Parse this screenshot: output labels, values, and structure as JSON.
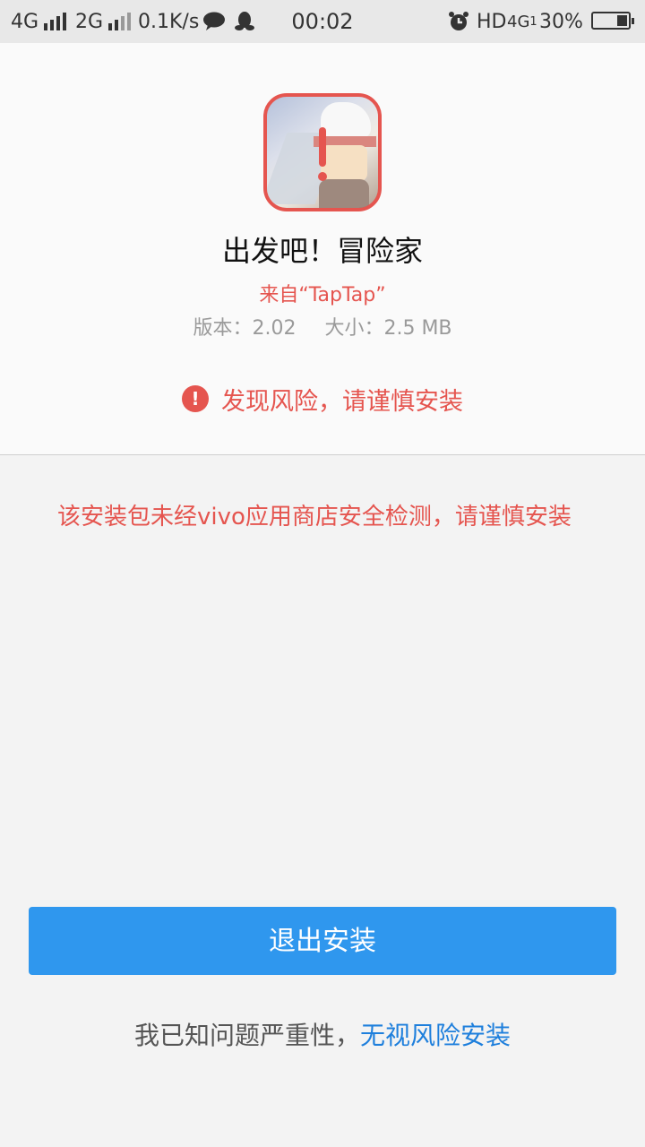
{
  "status_bar": {
    "sim1": "4G",
    "sim2": "2G",
    "speed": "0.1K/s",
    "time": "00:02",
    "hd": "HD",
    "net": "4G",
    "net_sub": "1",
    "battery_text": "30%",
    "battery_level": 0.3,
    "icons": [
      "signal-bars-icon",
      "message-bubble-icon",
      "qq-penguin-icon",
      "alarm-clock-icon",
      "battery-icon"
    ]
  },
  "app": {
    "name": "出发吧！冒险家",
    "source": "来自“TapTap”",
    "version": "版本：2.02",
    "size": "大小：2.5 MB",
    "icon": "app-icon-warning"
  },
  "risk": {
    "icon_symbol": "!",
    "title": "发现风险，请谨慎安装"
  },
  "warning_text": "该安装包未经vivo应用商店安全检测，请谨慎安装",
  "actions": {
    "exit_label": "退出安装",
    "ack_text": "我已知问题严重性，",
    "ignore_link": "无视风险安装"
  },
  "colors": {
    "accent_red": "#e5554f",
    "button_blue": "#2f97ee",
    "link_blue": "#1e7fdc"
  }
}
